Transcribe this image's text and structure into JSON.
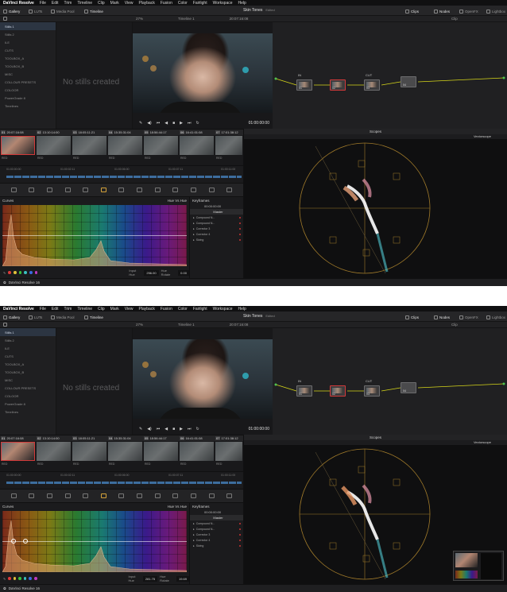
{
  "menu": [
    "DaVinci Resolve",
    "File",
    "Edit",
    "Trim",
    "Timeline",
    "Clip",
    "Mark",
    "View",
    "Playback",
    "Fusion",
    "Color",
    "Fairlight",
    "Workspace",
    "Help"
  ],
  "toolbar": {
    "gallery": "Gallery",
    "luts": "LUTs",
    "media_pool": "Media Pool",
    "timeline": "Timeline",
    "project_title": "Skin Tones",
    "edited": "Edited",
    "clips": "Clips",
    "nodes": "Nodes",
    "openfx": "OpenFX",
    "lightbox": "Lightbox"
  },
  "viewer": {
    "zoom": "27%",
    "timeline_name": "Timeline 1",
    "timecode_top": "20:07:16:08",
    "timecode": "01:00:00:00"
  },
  "nodes_panel": {
    "label": "Clip",
    "node_labels": [
      "IN",
      "CUT"
    ],
    "node_numbers": [
      "01",
      "02",
      "03",
      "04"
    ]
  },
  "gallery": {
    "items": [
      "Stills 1",
      "Stills 2",
      "ILE",
      "CUTS",
      "TOOLBOX_A",
      "TOOLBOX_B",
      "MISC",
      "COLLOUR PRESETS",
      "COLOOR",
      "PowerGrade 8",
      "Timelines"
    ],
    "empty_text": "No stills created"
  },
  "clips": [
    {
      "num": "01",
      "tc": "20:07:16:08",
      "cap": "RED"
    },
    {
      "num": "02",
      "tc": "13:10:14:00",
      "cap": "RED"
    },
    {
      "num": "03",
      "tc": "18:05:11:21",
      "cap": "RED"
    },
    {
      "num": "04",
      "tc": "15:35:31:04",
      "cap": "RED"
    },
    {
      "num": "05",
      "tc": "18:56:44:17",
      "cap": "RED"
    },
    {
      "num": "06",
      "tc": "16:41:01:08",
      "cap": "RED"
    },
    {
      "num": "07",
      "tc": "17:01:38:12",
      "cap": "RED"
    }
  ],
  "ruler": [
    "01:00:00:00",
    "01:00:02:11",
    "01:00:06:00",
    "01:00:07:11",
    "01:00:11:00"
  ],
  "curves": {
    "title": "Curves",
    "mode": "Hue Vs Hue",
    "input_hue_label": "Input Hue",
    "input_hue_top": "256.00",
    "input_hue_bottom": "281.75",
    "hue_rotate_label": "Hue Rotate",
    "hue_rotate_top": "0.00",
    "hue_rotate_bottom": "19.69",
    "swatches": [
      "#e03a3a",
      "#e0c03a",
      "#3ac03a",
      "#3ac0c0",
      "#3a6ae0",
      "#c03ac0"
    ]
  },
  "keyframes": {
    "title": "Keyframes",
    "timecode": "00:00:00:00",
    "rows": [
      "Master",
      "Compound N...",
      "Compound N...",
      "Corrector 3",
      "Corrector 4",
      "Sizing"
    ]
  },
  "scopes": {
    "title": "Scopes",
    "type": "Vectorscope"
  },
  "status": {
    "app": "DaVinci Resolve 16"
  }
}
